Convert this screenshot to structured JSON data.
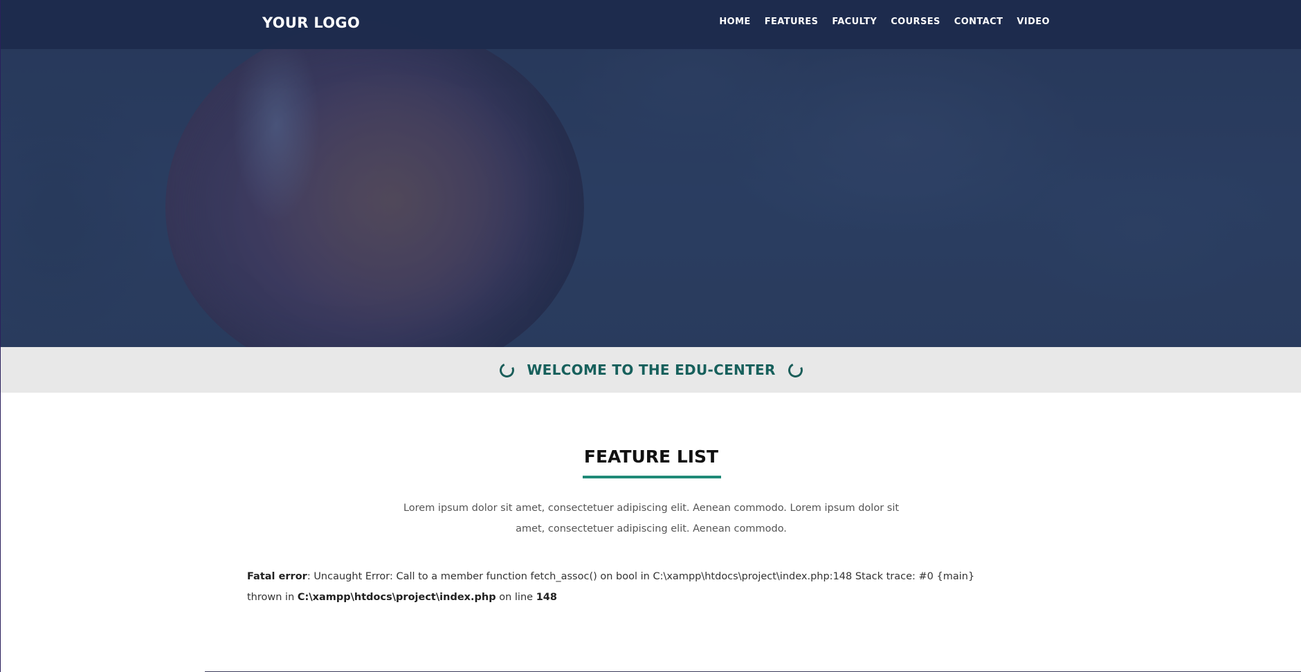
{
  "header": {
    "logo": "YOUR LOGO",
    "nav": [
      "HOME",
      "FEATURES",
      "FACULTY",
      "COURSES",
      "CONTACT",
      "VIDEO"
    ]
  },
  "welcome": {
    "text": "WELCOME TO THE EDU-CENTER",
    "icon": "spinner-icon"
  },
  "features": {
    "title": "FEATURE LIST",
    "description": "Lorem ipsum dolor sit amet, consectetuer adipiscing elit. Aenean commodo. Lorem ipsum dolor sit amet, consectetuer adipiscing elit. Aenean commodo."
  },
  "error": {
    "label": "Fatal error",
    "message": ": Uncaught Error: Call to a member function fetch_assoc() on bool in C:\\xampp\\htdocs\\project\\index.php:148 Stack trace: #0 {main} thrown in ",
    "file": "C:\\xampp\\htdocs\\project\\index.php",
    "on_line_text": " on line ",
    "line": "148"
  },
  "colors": {
    "navbar": "#1d2b4d",
    "accent": "#1f8a78",
    "welcome_text": "#17605c",
    "welcome_bg": "#e8e8e8"
  }
}
